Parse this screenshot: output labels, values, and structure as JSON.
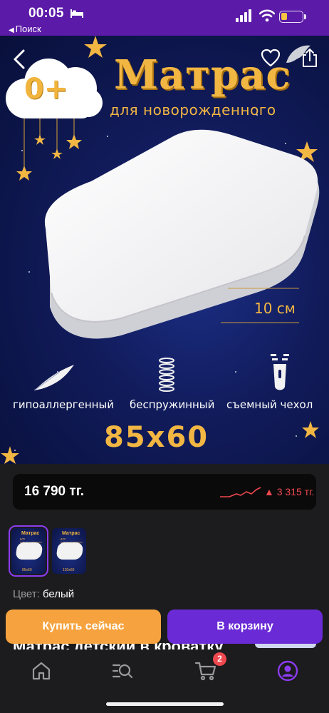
{
  "status_bar": {
    "time": "00:05",
    "back_label": "Поиск",
    "battery_color": "#f6c443"
  },
  "product_image": {
    "badge_text": "0+",
    "title": "Матрас",
    "subtitle": "для новорожденного",
    "thickness": "10 см",
    "features": [
      "гипоаллергенный",
      "беспружинный",
      "съемный чехол"
    ],
    "dimensions": "85x60",
    "icons": [
      "back-arrow-icon",
      "heart-icon",
      "share-icon",
      "feather-icon",
      "spring-icon",
      "zipper-icon"
    ]
  },
  "price": {
    "value": "16 790 тг.",
    "delta": "▲ 3 315 тг.",
    "delta_color": "#f0484f"
  },
  "thumbnails": [
    {
      "title": "Матрас",
      "subtitle": "для новорожденного",
      "size": "85x60",
      "selected": true
    },
    {
      "title": "Матрас",
      "subtitle": "для новорожденного",
      "size": "120x60",
      "selected": false
    }
  ],
  "color": {
    "label": "Цвет:",
    "value": "белый"
  },
  "product_title_peek": "Матрас детский в кроватку",
  "actions": {
    "buy_now": "Купить сейчас",
    "add_to_cart": "В корзину",
    "buy_color": "#f6a33f",
    "cart_color": "#6a2bd6"
  },
  "bottom_nav": {
    "items": [
      "home-icon",
      "catalog-search-icon",
      "cart-icon",
      "profile-icon"
    ],
    "cart_count": "2",
    "active_color": "#8b3cf0"
  }
}
